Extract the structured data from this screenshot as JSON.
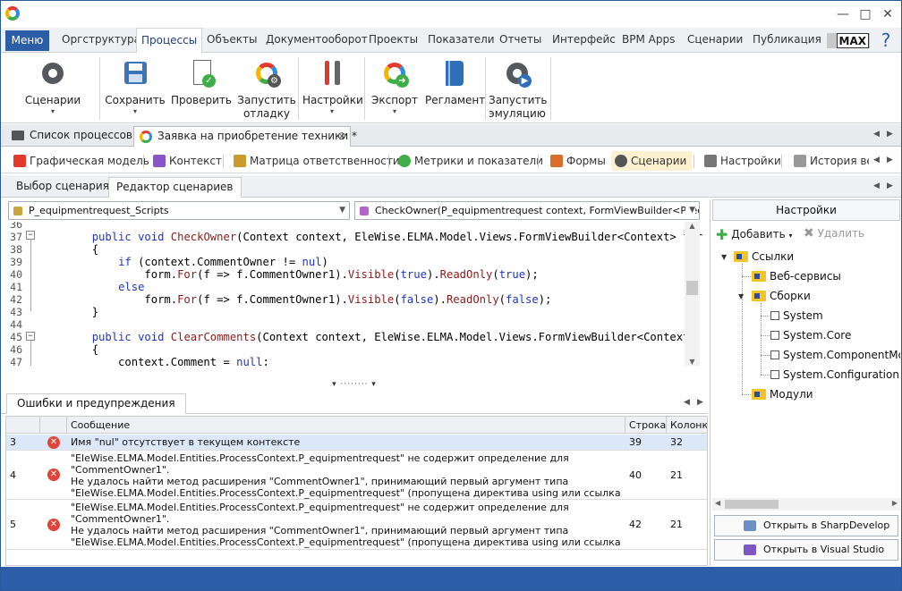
{
  "window": {
    "minimize": "—",
    "maximize": "□",
    "close": "✕"
  },
  "menubar": {
    "main_label": "Меню",
    "tabs": [
      "Оргструктура",
      "Процессы",
      "Объекты",
      "Документооборот",
      "Проекты",
      "Показатели",
      "Отчеты",
      "Интерфейс",
      "BPM Apps",
      "Сценарии",
      "Публикация"
    ],
    "active_tab": "Процессы",
    "max_label": "MAX",
    "help": "?"
  },
  "ribbon": {
    "scenarios": {
      "label": "Сценарии",
      "dd": "▾"
    },
    "save": {
      "label": "Сохранить",
      "dd": "▾"
    },
    "check": {
      "label": "Проверить"
    },
    "run_debug": {
      "line1": "Запустить",
      "line2": "отладку"
    },
    "settings": {
      "label": "Настройки",
      "dd": "▾"
    },
    "export": {
      "label": "Экспорт",
      "dd": "▾"
    },
    "regulation": {
      "label": "Регламент"
    },
    "run_emulation": {
      "line1": "Запустить",
      "line2": "эмуляцию"
    }
  },
  "doc_tabs": [
    {
      "label": "Список процессов"
    },
    {
      "label": "Заявка на приобретение техники *",
      "close": "⊗"
    }
  ],
  "doc_nav": {
    "left": "◀",
    "right": "▶"
  },
  "sub_tabs": [
    "Графическая модель",
    "Контекст",
    "Матрица ответственности",
    "Метрики и показатели",
    "Формы",
    "Сценарии",
    "Настройки",
    "История ве"
  ],
  "sub_active": "Сценарии",
  "editor_tabs": [
    "Выбор сценария",
    "Редактор сценариев"
  ],
  "editor_active": "Редактор сценариев",
  "combo_left": "P_equipmentrequest_Scripts",
  "combo_right": "CheckOwner(P_equipmentrequest context, FormViewBuilder<P_equipr",
  "code_lines": [
    {
      "n": "36",
      "text": ""
    },
    {
      "n": "37",
      "text": "        public void CheckOwner(Context context, EleWise.ELMA.Model.Views.FormViewBuilder<Context> form)"
    },
    {
      "n": "38",
      "text": "        {"
    },
    {
      "n": "39",
      "text": "            if (context.CommentOwner != nul)"
    },
    {
      "n": "40",
      "text": "                form.For(f => f.CommentOwner1).Visible(true).ReadOnly(true);"
    },
    {
      "n": "41",
      "text": "            else"
    },
    {
      "n": "42",
      "text": "                form.For(f => f.CommentOwner1).Visible(false).ReadOnly(false);"
    },
    {
      "n": "43",
      "text": "        }"
    },
    {
      "n": "44",
      "text": ""
    },
    {
      "n": "45",
      "text": "        public void ClearComments(Context context, EleWise.ELMA.Model.Views.FormViewBuilder<Context> form)"
    },
    {
      "n": "46",
      "text": "        {"
    },
    {
      "n": "47",
      "text": "            context.Comment = null;"
    }
  ],
  "splitter": "▾ ········ ▾",
  "errors_tab": "Ошибки и предупреждения",
  "grid": {
    "headers": {
      "msg": "Сообщение",
      "line": "Строка",
      "col": "Колонка"
    },
    "rows": [
      {
        "num": "3",
        "msg": "Имя \"nul\" отсутствует в текущем контексте",
        "line": "39",
        "col": "32"
      },
      {
        "num": "4",
        "msg": "\"EleWise.ELMA.Model.Entities.ProcessContext.P_equipmentrequest\" не содержит определение для \"CommentOwner1\".\nНе удалось найти метод  расширения \"CommentOwner1\", принимающий первый аргумент типа\n\"EleWise.ELMA.Model.Entities.ProcessContext.P_equipmentrequest\"  (пропущена директива using или ссылка на\nсборку?)",
        "line": "40",
        "col": "21"
      },
      {
        "num": "5",
        "msg": "\"EleWise.ELMA.Model.Entities.ProcessContext.P_equipmentrequest\" не содержит определение для \"CommentOwner1\".\nНе удалось найти метод  расширения \"CommentOwner1\", принимающий первый аргумент типа\n\"EleWise.ELMA.Model.Entities.ProcessContext.P_equipmentrequest\"  (пропущена директива using или ссылка на\nсборку?)",
        "line": "42",
        "col": "21"
      }
    ]
  },
  "right": {
    "header": "Настройки",
    "add": "Добавить",
    "add_dd": "▾",
    "delete": "Удалить",
    "tree": {
      "links": "Ссылки",
      "web": "Веб-сервисы",
      "assemblies": "Сборки",
      "system": "System",
      "core": "System.Core",
      "component": "System.ComponentModel",
      "config": "System.Configuration",
      "modules": "Модули"
    },
    "open_sharp": "Открыть в SharpDevelop",
    "open_vs": "Открыть в Visual Studio"
  },
  "colors": {
    "accent": "#2c5ea8",
    "error": "#e0443a",
    "selected_row": "#dce8f7",
    "active_subtab": "#fdf1cf"
  }
}
